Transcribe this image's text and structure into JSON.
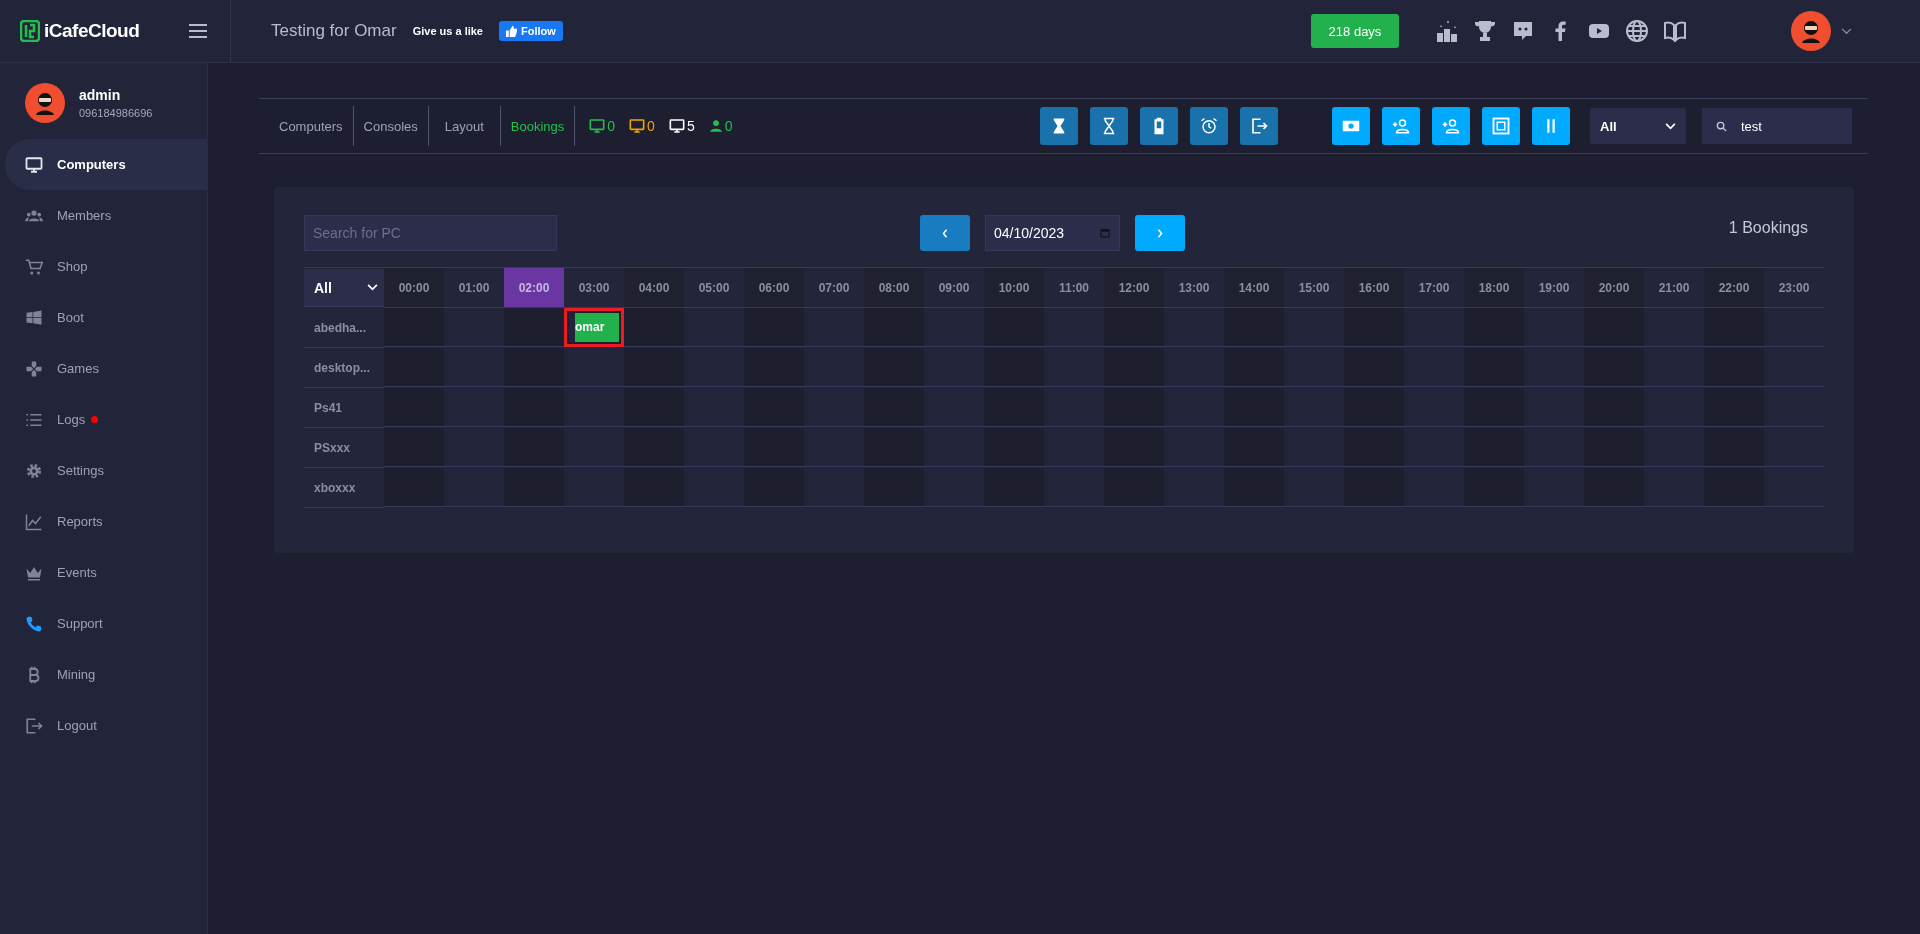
{
  "topbar": {
    "logo": "iCafeCloud",
    "title": "Testing for Omar",
    "like_text": "Give us a like",
    "follow_button": "Follow",
    "days_badge": "218 days",
    "icons": [
      {
        "kind": "ranking"
      },
      {
        "kind": "trophy"
      },
      {
        "kind": "chat"
      },
      {
        "kind": "facebook"
      },
      {
        "kind": "video"
      },
      {
        "kind": "globe"
      },
      {
        "kind": "book"
      }
    ]
  },
  "sidebar": {
    "user": {
      "name": "admin",
      "phone": "096184986696"
    },
    "items": [
      {
        "label": "Computers",
        "selected": true,
        "dot": false
      },
      {
        "label": "Members",
        "selected": false,
        "dot": false
      },
      {
        "label": "Shop",
        "selected": false,
        "dot": false
      },
      {
        "label": "Boot",
        "selected": false,
        "dot": false
      },
      {
        "label": "Games",
        "selected": false,
        "dot": false
      },
      {
        "label": "Logs",
        "selected": false,
        "dot": true
      },
      {
        "label": "Settings",
        "selected": false,
        "dot": false
      },
      {
        "label": "Reports",
        "selected": false,
        "dot": false
      },
      {
        "label": "Events",
        "selected": false,
        "dot": false
      },
      {
        "label": "Support",
        "selected": false,
        "dot": false
      },
      {
        "label": "Mining",
        "selected": false,
        "dot": false
      },
      {
        "label": "Logout",
        "selected": false,
        "dot": false
      }
    ]
  },
  "toolbar": {
    "tabs": [
      {
        "label": "Computers",
        "selected": false
      },
      {
        "label": "Consoles",
        "selected": false
      },
      {
        "label": "Layout",
        "selected": false
      },
      {
        "label": "Bookings",
        "selected": true
      }
    ],
    "counters": [
      {
        "kind": "monitor",
        "value": "0",
        "color": "#22c04a"
      },
      {
        "kind": "monitor",
        "value": "0",
        "color": "#f0a500"
      },
      {
        "kind": "monitor",
        "value": "5",
        "color": "#ffffff"
      },
      {
        "kind": "person",
        "value": "0",
        "color": "#22c04a"
      }
    ],
    "actions": [
      {
        "kind": "hourglass-end"
      },
      {
        "kind": "hourglass"
      },
      {
        "kind": "battery"
      },
      {
        "kind": "alarm"
      },
      {
        "kind": "exit"
      },
      {
        "kind": "money"
      },
      {
        "kind": "user-add"
      },
      {
        "kind": "user-add"
      },
      {
        "kind": "frame"
      },
      {
        "kind": "pause"
      }
    ],
    "filter": "All",
    "search": "test"
  },
  "bookings": {
    "search_placeholder": "Search for PC",
    "date": "04/10/2023",
    "count": "1 Bookings",
    "filter": "All",
    "hours": [
      {
        "label": "00:00",
        "selected": false
      },
      {
        "label": "01:00",
        "selected": false
      },
      {
        "label": "02:00",
        "selected": true
      },
      {
        "label": "03:00",
        "selected": false
      },
      {
        "label": "04:00",
        "selected": false
      },
      {
        "label": "05:00",
        "selected": false
      },
      {
        "label": "06:00",
        "selected": false
      },
      {
        "label": "07:00",
        "selected": false
      },
      {
        "label": "08:00",
        "selected": false
      },
      {
        "label": "09:00",
        "selected": false
      },
      {
        "label": "10:00",
        "selected": false
      },
      {
        "label": "11:00",
        "selected": false
      },
      {
        "label": "12:00",
        "selected": false
      },
      {
        "label": "13:00",
        "selected": false
      },
      {
        "label": "14:00",
        "selected": false
      },
      {
        "label": "15:00",
        "selected": false
      },
      {
        "label": "16:00",
        "selected": false
      },
      {
        "label": "17:00",
        "selected": false
      },
      {
        "label": "18:00",
        "selected": false
      },
      {
        "label": "19:00",
        "selected": false
      },
      {
        "label": "20:00",
        "selected": false
      },
      {
        "label": "21:00",
        "selected": false
      },
      {
        "label": "22:00",
        "selected": false
      },
      {
        "label": "23:00",
        "selected": false
      }
    ],
    "rows": [
      {
        "pc": "abedha...",
        "cells": [
          {
            "kind": "empty"
          },
          {
            "kind": "empty"
          },
          {
            "kind": "empty"
          },
          {
            "kind": "booking",
            "label": "omar",
            "highlighted": true
          }
        ]
      },
      {
        "pc": "desktop..."
      },
      {
        "pc": "Ps41"
      },
      {
        "pc": "PSxxx"
      },
      {
        "pc": "xboxxx"
      }
    ]
  }
}
